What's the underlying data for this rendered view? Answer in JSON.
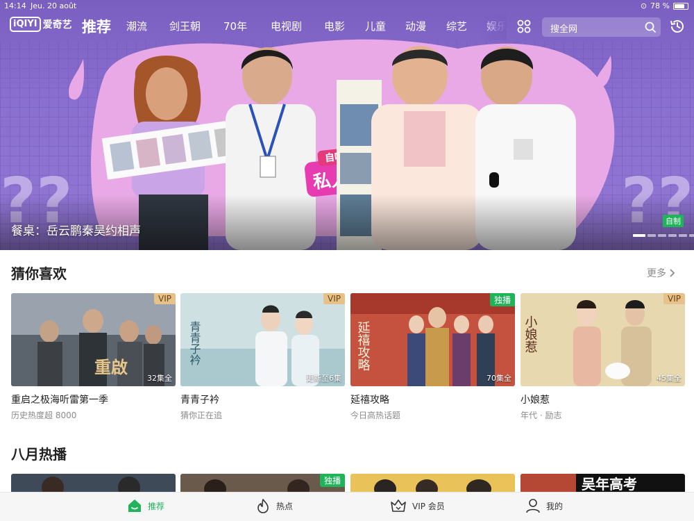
{
  "status_bar": {
    "time": "14:14",
    "date": "Jeu. 20 août",
    "battery": "78 %",
    "battery_level": 0.78
  },
  "app": {
    "logo": "iQIYI",
    "logo_text": "爱奇艺"
  },
  "nav": {
    "items": [
      "推荐",
      "潮流",
      "剑王朝",
      "70年",
      "电视剧",
      "电影",
      "儿童",
      "动漫",
      "综艺",
      "娱乐"
    ],
    "active": "推荐"
  },
  "search": {
    "placeholder": "搜全网"
  },
  "hero": {
    "caption": "餐桌：岳云鹏秦昊约相声",
    "badge": "自制",
    "slides": 6,
    "active_slide": 1,
    "show_logo": "自嗨锅 私人餐桌"
  },
  "guess": {
    "title": "猜你喜欢",
    "more": "更多",
    "cards": [
      {
        "title": "重启之极海听雷第一季",
        "subtitle": "历史热度超 8000",
        "badge": "VIP",
        "episodes": "32集全",
        "poster_text": "重啟"
      },
      {
        "title": "青青子衿",
        "subtitle": "猜你正在追",
        "badge": "VIP",
        "episodes": "更新至6集",
        "poster_text": "青青子衿"
      },
      {
        "title": "延禧攻略",
        "subtitle": "今日高热话题",
        "badge": "独播",
        "episodes": "70集全",
        "poster_text": "延禧攻略"
      },
      {
        "title": "小娘惹",
        "subtitle": "年代 · 励志",
        "badge": "VIP",
        "episodes": "45集全",
        "poster_text": "小娘惹"
      }
    ]
  },
  "august": {
    "title": "八月热播",
    "cards": [
      {
        "badge": ""
      },
      {
        "badge": "独播"
      },
      {
        "badge": ""
      },
      {
        "badge": "",
        "poster_text": "吴年高考"
      }
    ]
  },
  "tabbar": {
    "items": [
      "推荐",
      "热点",
      "VIP 会员",
      "我的"
    ],
    "active": "推荐"
  },
  "colors": {
    "brand_green": "#1fb35a",
    "hero_purple": "#7a5ec0",
    "vip_gold": "#e6c28a"
  }
}
